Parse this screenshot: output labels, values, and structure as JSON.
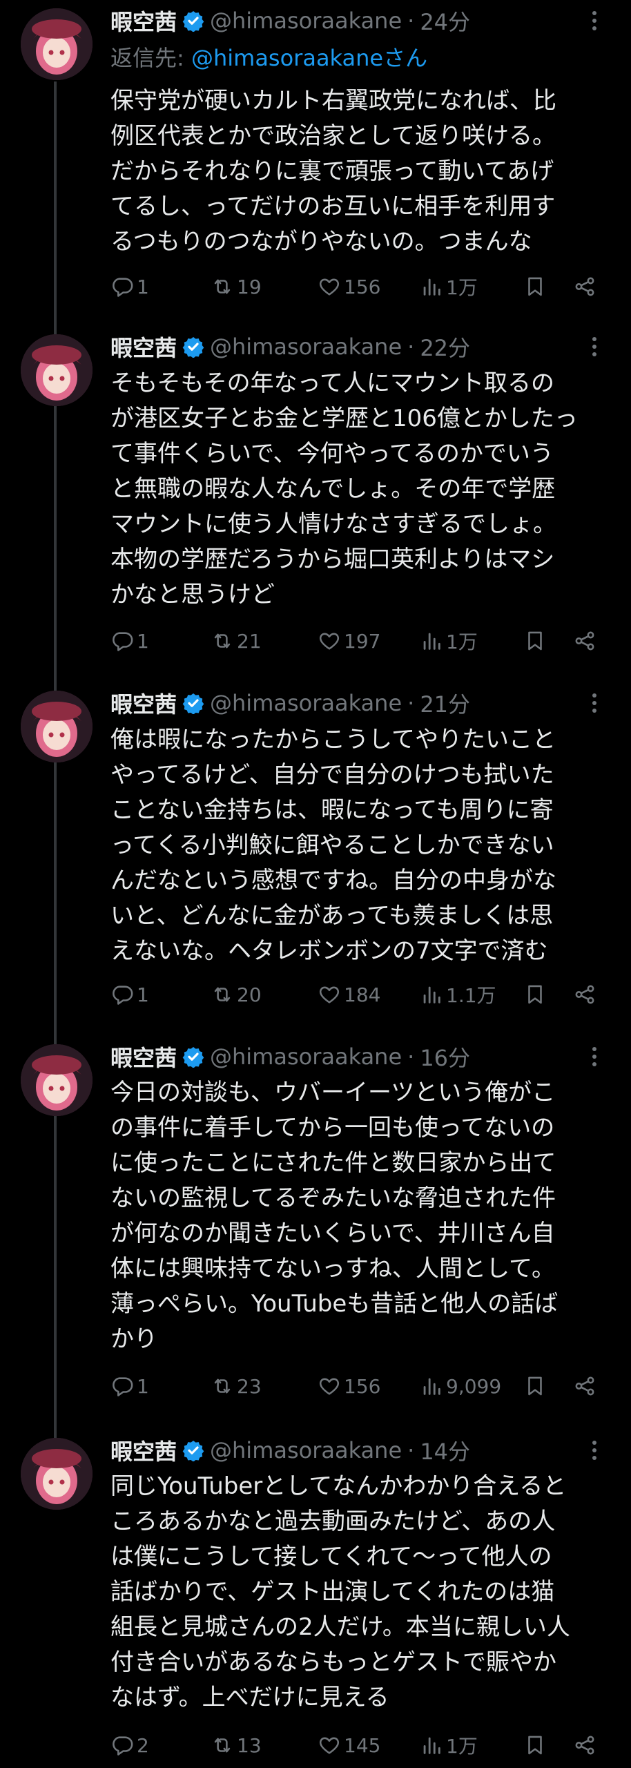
{
  "colors": {
    "background": "#000000",
    "text": "#e7e9ea",
    "secondary": "#71767b",
    "link": "#1d9bf0",
    "verified": "#1d9bf0"
  },
  "reply_prefix": "返信先: ",
  "reply_target": "@himasoraakaneさん",
  "tweets": [
    {
      "name": "暇空茜",
      "handle": "@himasoraakane",
      "separator": "·",
      "time": "24分",
      "text": "保守党が硬いカルト右翼政党になれば、比\n例区代表とかで政治家として返り咲ける。\nだからそれなりに裏で頑張って動いてあげ\nてるし、ってだけのお互いに相手を利用す\nるつもりのつながりやないの。つまんな",
      "replies": "1",
      "retweets": "19",
      "likes": "156",
      "views": "1万"
    },
    {
      "name": "暇空茜",
      "handle": "@himasoraakane",
      "separator": "·",
      "time": "22分",
      "text": "そもそもその年なって人にマウント取るの\nが港区女子とお金と学歴と106億とかしたっ\nて事件くらいで、今何やってるのかでいう\nと無職の暇な人なんでしょ。その年で学歴\nマウントに使う人情けなさすぎるでしょ。\n本物の学歴だろうから堀口英利よりはマシ\nかなと思うけど",
      "replies": "1",
      "retweets": "21",
      "likes": "197",
      "views": "1万"
    },
    {
      "name": "暇空茜",
      "handle": "@himasoraakane",
      "separator": "·",
      "time": "21分",
      "text": "俺は暇になったからこうしてやりたいこと\nやってるけど、自分で自分のけつも拭いた\nことない金持ちは、暇になっても周りに寄\nってくる小判鮫に餌やることしかできない\nんだなという感想ですね。自分の中身がな\nいと、どんなに金があっても羨ましくは思\nえないな。ヘタレボンボンの7文字で済む",
      "replies": "1",
      "retweets": "20",
      "likes": "184",
      "views": "1.1万"
    },
    {
      "name": "暇空茜",
      "handle": "@himasoraakane",
      "separator": "·",
      "time": "16分",
      "text": "今日の対談も、ウバーイーツという俺がこ\nの事件に着手してから一回も使ってないの\nに使ったことにされた件と数日家から出て\nないの監視してるぞみたいな脅迫された件\nが何なのか聞きたいくらいで、井川さん自\n体には興味持てないっすね、人間として。\n薄っぺらい。YouTubeも昔話と他人の話ば\nかり",
      "replies": "1",
      "retweets": "23",
      "likes": "156",
      "views": "9,099"
    },
    {
      "name": "暇空茜",
      "handle": "@himasoraakane",
      "separator": "·",
      "time": "14分",
      "text": "同じYouTuberとしてなんかわかり合えると\nころあるかなと過去動画みたけど、あの人\nは僕にこうして接してくれて〜って他人の\n話ばかりで、ゲスト出演してくれたのは猫\n組長と見城さんの2人だけ。本当に親しい人\n付き合いがあるならもっとゲストで賑やか\nなはず。上べだけに見える",
      "replies": "2",
      "retweets": "13",
      "likes": "145",
      "views": "1万"
    }
  ]
}
